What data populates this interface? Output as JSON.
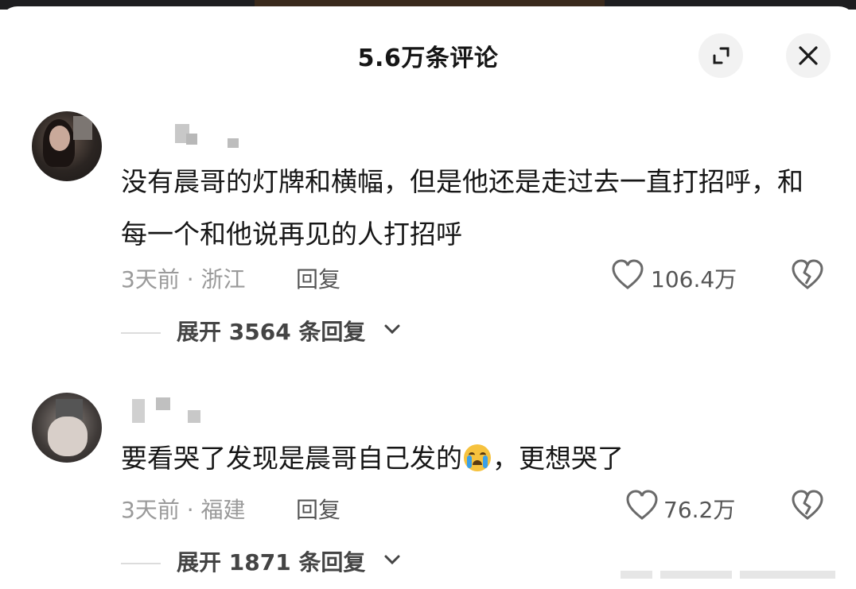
{
  "header": {
    "title": "5.6万条评论",
    "expand_icon": "expand-icon",
    "close_icon": "close-icon"
  },
  "comments": [
    {
      "text": "没有晨哥的灯牌和横幅，但是他还是走过去一直打招呼，和每一个和他说再见的人打招呼",
      "meta": "3天前 · 浙江",
      "reply_label": "回复",
      "likes": "106.4万",
      "expand_label": "展开 3564 条回复"
    },
    {
      "text_before_emoji": "要看哭了发现是晨哥自己发的",
      "emoji": "loudly-crying-face",
      "text_after_emoji": "，更想哭了",
      "meta": "3天前 · 福建",
      "reply_label": "回复",
      "likes": "76.2万",
      "expand_label": "展开 1871 条回复"
    }
  ],
  "colors": {
    "text": "#161616",
    "muted": "#9a9a9a",
    "secondary": "#555555",
    "button_bg": "#f2f2f2"
  }
}
